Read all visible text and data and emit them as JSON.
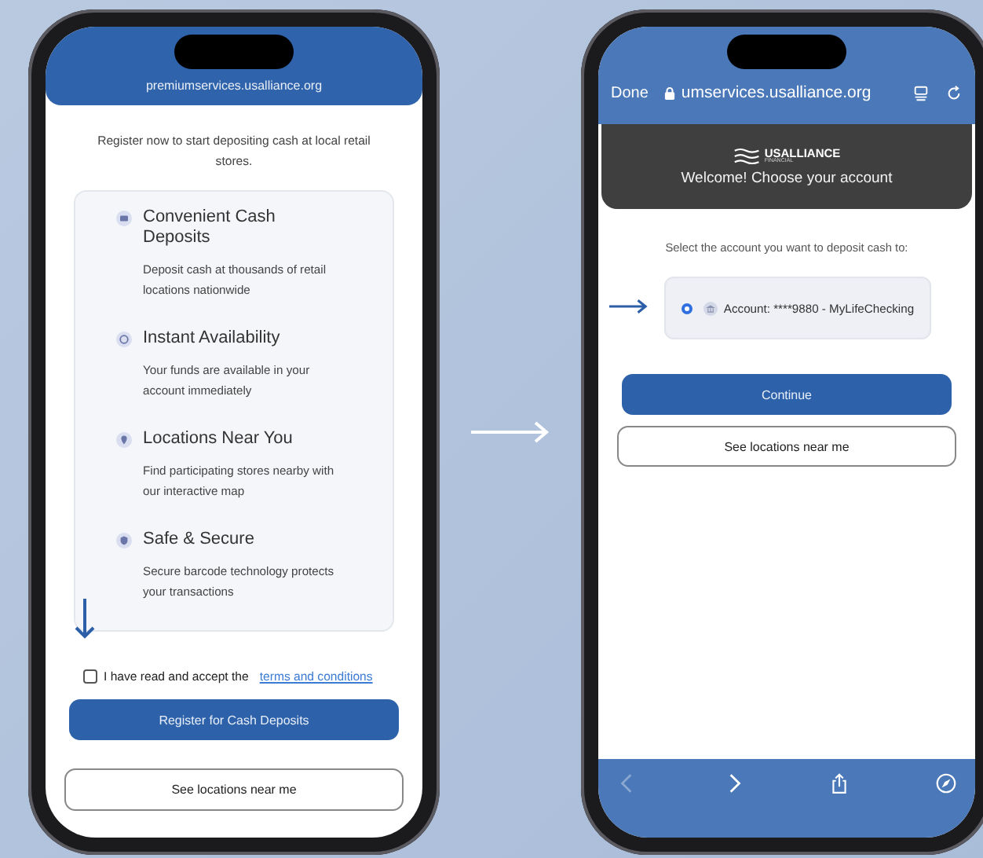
{
  "left_screen": {
    "url": "premiumservices.usalliance.org",
    "intro": "Register now to start depositing cash at local retail stores.",
    "features": [
      {
        "kind": "cash",
        "title": "Convenient Cash Deposits",
        "description": "Deposit cash at thousands of retail locations nationwide"
      },
      {
        "kind": "clock",
        "title": "Instant Availability",
        "description": "Your funds are available in your account immediately"
      },
      {
        "kind": "pin",
        "title": "Locations Near You",
        "description": "Find participating stores nearby with our interactive map"
      },
      {
        "kind": "shield",
        "title": "Safe & Secure",
        "description": "Secure barcode technology protects your transactions"
      }
    ],
    "terms": {
      "label": "I have read and accept the",
      "link": "terms and conditions",
      "checked": false
    },
    "primary_button": "Register for Cash Deposits",
    "secondary_button": "See locations near me"
  },
  "right_screen": {
    "done": "Done",
    "url": "umservices.usalliance.org",
    "brand": {
      "name": "USALLIANCE",
      "tagline": "FINANCIAL"
    },
    "welcome": "Welcome! Choose your account",
    "prompt": "Select the account you want to deposit cash to:",
    "accounts": [
      {
        "label": "Account: ****9880 - MyLifeChecking",
        "selected": true
      }
    ],
    "primary_button": "Continue",
    "secondary_button": "See locations near me",
    "toolbar": [
      {
        "kind": "back",
        "disabled": true
      },
      {
        "kind": "forward",
        "disabled": false
      },
      {
        "kind": "share",
        "disabled": false
      },
      {
        "kind": "compass",
        "disabled": false
      }
    ]
  }
}
